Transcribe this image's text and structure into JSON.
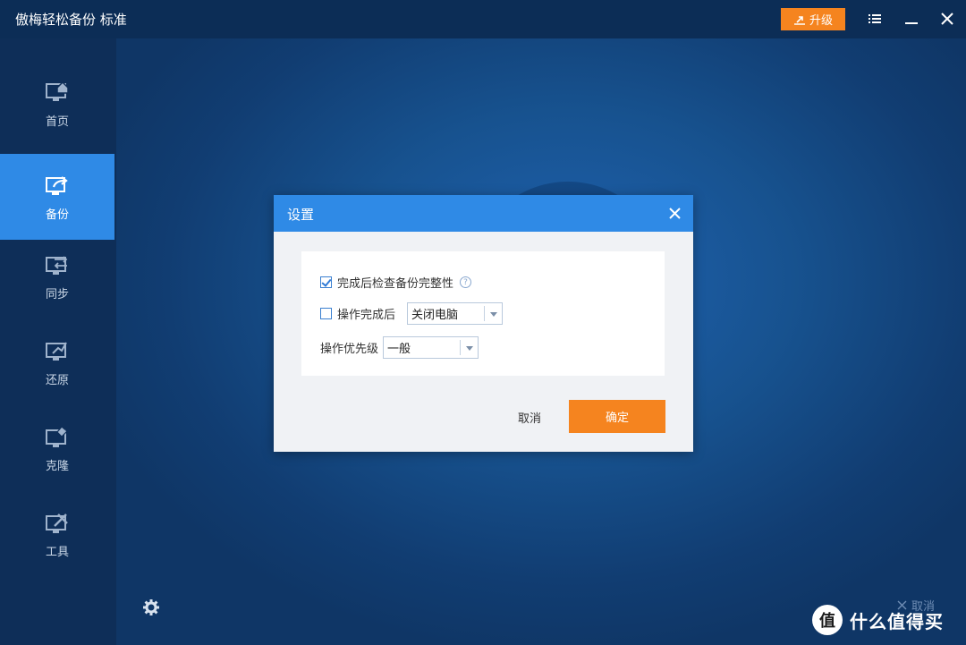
{
  "app": {
    "title": "傲梅轻松备份 标准"
  },
  "titlebar": {
    "upgrade_label": "升级"
  },
  "sidebar": {
    "items": [
      {
        "label": "首页",
        "icon": "home-monitor-icon"
      },
      {
        "label": "备份",
        "icon": "backup-monitor-icon",
        "active": true
      },
      {
        "label": "同步",
        "icon": "sync-monitor-icon"
      },
      {
        "label": "还原",
        "icon": "restore-monitor-icon"
      },
      {
        "label": "克隆",
        "icon": "clone-monitor-icon"
      },
      {
        "label": "工具",
        "icon": "tools-monitor-icon"
      }
    ]
  },
  "main": {
    "cancel_label": "取消"
  },
  "dialog": {
    "title": "设置",
    "check_integrity_label": "完成后检查备份完整性",
    "check_integrity_checked": true,
    "after_op_label": "操作完成后",
    "after_op_checked": false,
    "after_op_value": "关闭电脑",
    "priority_label": "操作优先级",
    "priority_value": "一般",
    "cancel_label": "取消",
    "ok_label": "确定"
  },
  "watermark": {
    "text": "什么值得买",
    "logo_char": "值"
  },
  "colors": {
    "accent_blue": "#2f8ae6",
    "accent_orange": "#f5841f",
    "sidebar_bg": "#0e2e58"
  }
}
